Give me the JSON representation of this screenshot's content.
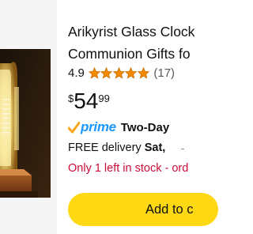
{
  "product": {
    "title_line1": "Arikyrist Glass Clock",
    "title_line2": "Communion Gifts fo",
    "rating_value": "4.9",
    "rating_stars": 4.9,
    "rating_count": "(17)",
    "price_symbol": "$",
    "price_whole": "54",
    "price_fraction": "99",
    "prime_label": "prime",
    "prime_speed": "Two-Day",
    "delivery_prefix": "FREE delivery",
    "delivery_day": "Sat,",
    "stock_text": "Only 1 left in stock - ord",
    "add_to_cart_label": "Add to c"
  },
  "colors": {
    "star": "#f28b00",
    "prime_blue": "#1a98ff",
    "prime_check": "#f7a51a",
    "stock_red": "#cc0c39",
    "button_yellow": "#ffd814"
  },
  "icons": {
    "rating": "star-icon",
    "prime": "prime-check-icon"
  }
}
